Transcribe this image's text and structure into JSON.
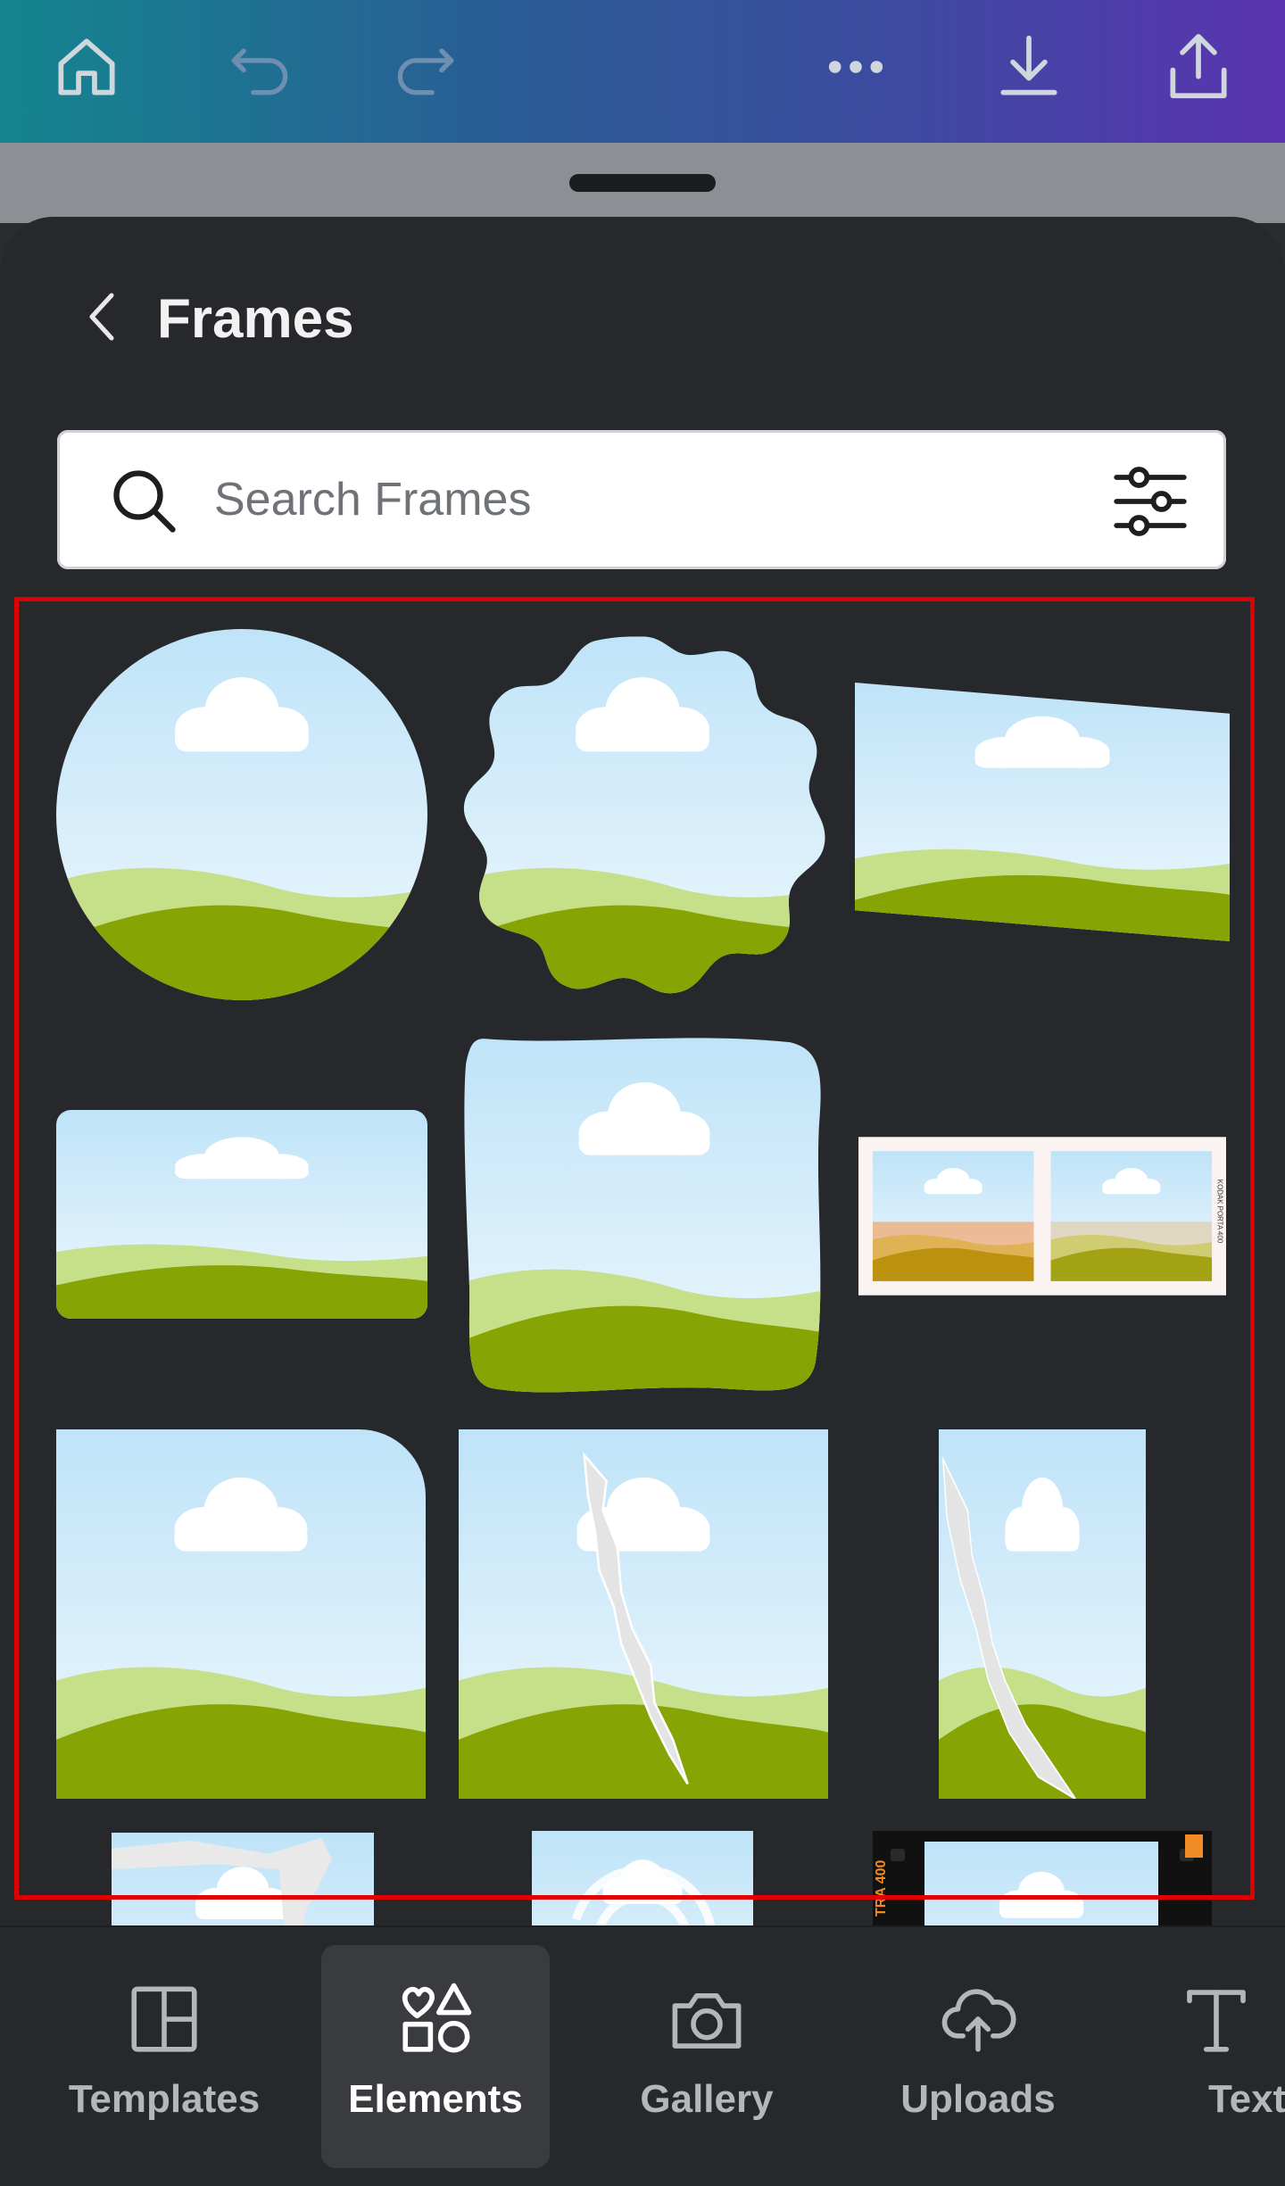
{
  "toolbar": {
    "home_icon": "home-icon",
    "undo_icon": "undo-icon",
    "redo_icon": "redo-icon",
    "more_icon": "more-icon",
    "download_icon": "download-icon",
    "share_icon": "share-icon"
  },
  "panel": {
    "title": "Frames",
    "back_icon": "chevron-left-icon"
  },
  "search": {
    "placeholder": "Search Frames",
    "search_icon": "search-icon",
    "filter_icon": "filter-sliders-icon"
  },
  "frames": [
    {
      "shape": "circle"
    },
    {
      "shape": "scalloped"
    },
    {
      "shape": "skewed-rectangle"
    },
    {
      "shape": "rounded-rectangle"
    },
    {
      "shape": "rough-square"
    },
    {
      "shape": "film-strip-double",
      "strip_text": "KODAK PORTA 400"
    },
    {
      "shape": "rounded-corner-square"
    },
    {
      "shape": "torn-paper"
    },
    {
      "shape": "torn-paper-narrow"
    },
    {
      "shape": "torn-edge-partial"
    },
    {
      "shape": "brush-partial"
    },
    {
      "shape": "film-negative-partial",
      "strip_text": "TRA 400"
    }
  ],
  "bottom_nav": {
    "items": [
      {
        "label": "Templates",
        "icon": "templates-icon",
        "active": false
      },
      {
        "label": "Elements",
        "icon": "elements-icon",
        "active": true
      },
      {
        "label": "Gallery",
        "icon": "camera-icon",
        "active": false
      },
      {
        "label": "Uploads",
        "icon": "cloud-upload-icon",
        "active": false
      },
      {
        "label": "Text",
        "icon": "text-icon",
        "active": false
      }
    ]
  },
  "colors": {
    "sky_top": "#bfe3f8",
    "sky_bottom": "#eef8fd",
    "hill_light": "#c5e088",
    "hill_dark": "#86a403",
    "highlight_box": "#e00000"
  }
}
